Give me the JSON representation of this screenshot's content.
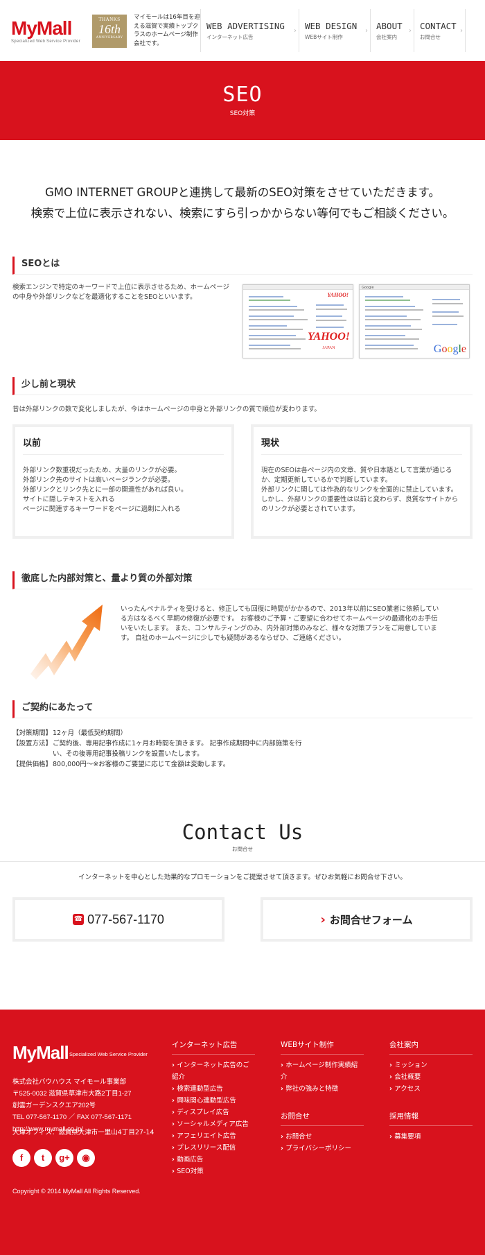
{
  "header": {
    "logo": {
      "text": "MyMall",
      "tagline": "Specialized Web Service Provider"
    },
    "badge": {
      "top": "THANKS",
      "number": "16th",
      "bottom": "ANNIVERSARY"
    },
    "intro": "マイモールは16年目を迎える滋賀で実績トップクラスのホームページ制作会社です。",
    "nav": [
      {
        "en": "WEB ADVERTISING",
        "jp": "インターネット広告"
      },
      {
        "en": "WEB DESIGN",
        "jp": "WEBサイト制作"
      },
      {
        "en": "ABOUT",
        "jp": "会社案内"
      },
      {
        "en": "CONTACT",
        "jp": "お問合せ"
      }
    ]
  },
  "banner": {
    "title": "SEO",
    "subtitle": "SEO対策"
  },
  "lead": {
    "line1": "GMO INTERNET GROUPと連携して最新のSEO対策をさせていただきます。",
    "line2": "検索で上位に表示されない、検索にすら引っかからない等何でもご相談ください。"
  },
  "sections": {
    "what_is_seo": {
      "heading": "SEOとは",
      "text": "検索エンジンで特定のキーワードで上位に表示させるため、ホームページの中身や外部リンクなどを最適化することをSEOといいます。",
      "yahoo_logo": "YAHOO!",
      "yahoo_sub": "JAPAN",
      "google_logo": [
        "G",
        "o",
        "o",
        "g",
        "l",
        "e"
      ]
    },
    "then_now": {
      "heading": "少し前と現状",
      "text": "昔は外部リンクの数で変化しましたが、今はホームページの中身と外部リンクの質で順位が変わります。",
      "before": {
        "title": "以前",
        "lines": [
          "外部リンク数重視だったため、大量のリンクが必要。",
          "外部リンク先のサイトは高いページランクが必要。",
          "外部リンクとリンク先とに一部の関連性があれば良い。",
          "サイトに隠しテキストを入れる",
          "ページに関連するキーワードをページに過剰に入れる"
        ]
      },
      "now": {
        "title": "現状",
        "lines": [
          "現在のSEOは各ページ内の文章、質や日本語として言葉が通じるか、定期更新しているかで判断しています。",
          "外部リンクに関しては作為的なリンクを全面的に禁止しています。",
          "しかし、外部リンクの重要性は以前と変わらず、良質なサイトからのリンクが必要とされています。"
        ]
      }
    },
    "measures": {
      "heading": "徹底した内部対策と、量より質の外部対策",
      "text": "いったんペナルティを受けると、修正しても回復に時間がかかるので、2013年以前にSEO業者に依頼している方はなるべく早期の修復が必要です。 お客様のご予算・ご要望に合わせてホームページの最適化のお手伝いをいたします。 また、コンサルティングのみ、内外部対策のみなど、様々な対策プランをご用意しています。 自社のホームページに少しでも疑問があるならぜひ、ご連絡ください。"
    },
    "contract": {
      "heading": "ご契約にあたって",
      "terms": [
        {
          "key": "【対策期間】",
          "value": "12ヶ月（最低契約期間）"
        },
        {
          "key": "【設置方法】",
          "value": "ご契約後、専用記事作成に1ヶ月お時間を頂きます。 記事作成期間中に内部施策を行い、その後専用記事投稿リンクを設置いたします。"
        },
        {
          "key": "【提供価格】",
          "value": "800,000円〜※お客様のご要望に応じて金額は変動します。"
        }
      ]
    }
  },
  "contact": {
    "title": "Contact Us",
    "subtitle": "お問合せ",
    "text": "インターネットを中心とした効果的なプロモーションをご提案させて頂きます。ぜひお気軽にお問合せ下さい。",
    "phone": "077-567-1170",
    "form_label": "お問合せフォーム"
  },
  "footer": {
    "logo": "MyMall",
    "logo_sub": "Specialized Web Service Provider",
    "company": "株式会社バウハウス マイモール事業部",
    "address1": "〒525-0032 滋賀県草津市大路2丁目1-27",
    "address2": "創雲ガーデンスクエア202号",
    "tel_fax": "TEL 077-567-1170 ／ FAX 077-567-1171",
    "url": "http://www.mymall.co.jp/",
    "office": "大津オフィス：滋賀県大津市一里山4丁目27-14",
    "social": [
      "facebook-icon",
      "twitter-icon",
      "googleplus-icon",
      "rss-icon"
    ],
    "columns": {
      "ads": {
        "title": "インターネット広告",
        "links": [
          "インターネット広告のご紹介",
          "検索連動型広告",
          "興味関心連動型広告",
          "ディスプレイ広告",
          "ソーシャルメディア広告",
          "アフェリエイト広告",
          "プレスリリース配信",
          "動画広告",
          "SEO対策"
        ]
      },
      "web": {
        "title": "WEBサイト制作",
        "links": [
          "ホームページ制作実績紹介",
          "弊社の強みと特徴"
        ]
      },
      "contact": {
        "title": "お問合せ",
        "links": [
          "お問合せ",
          "プライバシーポリシー"
        ]
      },
      "about": {
        "title": "会社案内",
        "links": [
          "ミッション",
          "会社概要",
          "アクセス"
        ]
      },
      "recruit": {
        "title": "採用情報",
        "links": [
          "募集要項"
        ]
      }
    },
    "copyright": "Copyright © 2014 MyMall All Rights Reserved."
  }
}
